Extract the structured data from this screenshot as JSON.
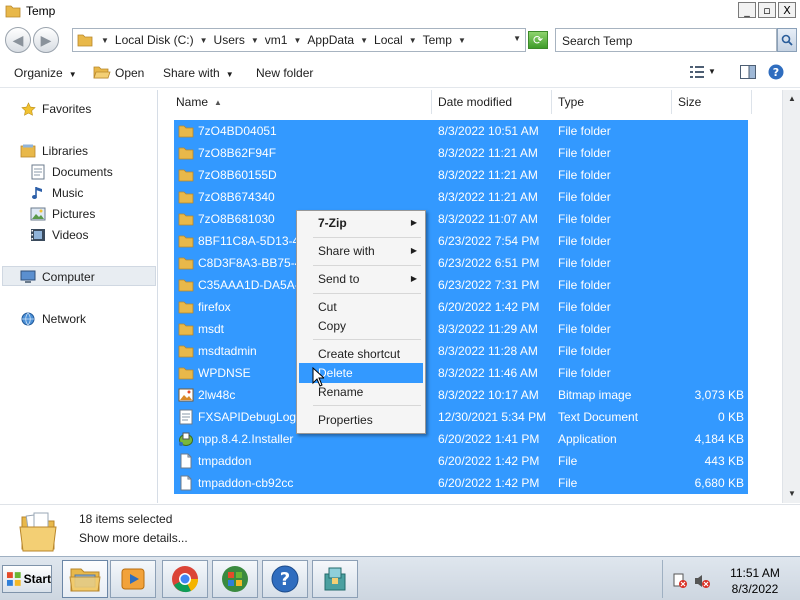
{
  "window": {
    "title": "Temp",
    "minimize_label": "_",
    "maximize_label": "▫",
    "close_label": "X"
  },
  "address": {
    "crumbs": [
      "Local Disk (C:)",
      "Users",
      "vm1",
      "AppData",
      "Local",
      "Temp"
    ],
    "search_placeholder": "Search Temp"
  },
  "commandbar": {
    "organize": "Organize",
    "open": "Open",
    "share_with": "Share with",
    "new_folder": "New folder"
  },
  "nav": {
    "favorites": "Favorites",
    "libraries": "Libraries",
    "documents": "Documents",
    "music": "Music",
    "pictures": "Pictures",
    "videos": "Videos",
    "computer": "Computer",
    "network": "Network"
  },
  "columns": {
    "name": "Name",
    "date_modified": "Date modified",
    "type": "Type",
    "size": "Size"
  },
  "files": [
    {
      "name": "7zO4BD04051",
      "date": "8/3/2022 10:51 AM",
      "type": "File folder",
      "size": "",
      "icon": "folder"
    },
    {
      "name": "7zO8B62F94F",
      "date": "8/3/2022 11:21 AM",
      "type": "File folder",
      "size": "",
      "icon": "folder"
    },
    {
      "name": "7zO8B60155D",
      "date": "8/3/2022 11:21 AM",
      "type": "File folder",
      "size": "",
      "icon": "folder"
    },
    {
      "name": "7zO8B674340",
      "date": "8/3/2022 11:21 AM",
      "type": "File folder",
      "size": "",
      "icon": "folder"
    },
    {
      "name": "7zO8B681030",
      "date": "8/3/2022 11:07 AM",
      "type": "File folder",
      "size": "",
      "icon": "folder"
    },
    {
      "name": "8BF11C8A-5D13-4",
      "date": "6/23/2022 7:54 PM",
      "type": "File folder",
      "size": "",
      "icon": "folder"
    },
    {
      "name": "C8D3F8A3-BB75-4",
      "date": "6/23/2022 6:51 PM",
      "type": "File folder",
      "size": "",
      "icon": "folder"
    },
    {
      "name": "C35AAA1D-DA5A-",
      "date": "6/23/2022 7:31 PM",
      "type": "File folder",
      "size": "",
      "icon": "folder"
    },
    {
      "name": "firefox",
      "date": "6/20/2022 1:42 PM",
      "type": "File folder",
      "size": "",
      "icon": "folder"
    },
    {
      "name": "msdt",
      "date": "8/3/2022 11:29 AM",
      "type": "File folder",
      "size": "",
      "icon": "folder"
    },
    {
      "name": "msdtadmin",
      "date": "8/3/2022 11:28 AM",
      "type": "File folder",
      "size": "",
      "icon": "folder"
    },
    {
      "name": "WPDNSE",
      "date": "8/3/2022 11:46 AM",
      "type": "File folder",
      "size": "",
      "icon": "folder"
    },
    {
      "name": "2lw48c",
      "date": "8/3/2022 10:17 AM",
      "type": "Bitmap image",
      "size": "3,073 KB",
      "icon": "bitmap"
    },
    {
      "name": "FXSAPIDebugLogF",
      "date": "12/30/2021 5:34 PM",
      "type": "Text Document",
      "size": "0 KB",
      "icon": "text"
    },
    {
      "name": "npp.8.4.2.Installer",
      "date": "6/20/2022 1:41 PM",
      "type": "Application",
      "size": "4,184 KB",
      "icon": "app"
    },
    {
      "name": "tmpaddon",
      "date": "6/20/2022 1:42 PM",
      "type": "File",
      "size": "443 KB",
      "icon": "file"
    },
    {
      "name": "tmpaddon-cb92cc",
      "date": "6/20/2022 1:42 PM",
      "type": "File",
      "size": "6,680 KB",
      "icon": "file"
    }
  ],
  "context_menu": {
    "items": [
      {
        "label": "7-Zip",
        "submenu": true,
        "bold": true
      },
      {
        "label": "Share with",
        "submenu": true
      },
      {
        "label": "Send to",
        "submenu": true
      },
      {
        "label": "Cut"
      },
      {
        "label": "Copy"
      },
      {
        "label": "Create shortcut"
      },
      {
        "label": "Delete",
        "highlighted": true
      },
      {
        "label": "Rename"
      },
      {
        "label": "Properties"
      }
    ]
  },
  "details": {
    "selected": "18 items selected",
    "more": "Show more details..."
  },
  "taskbar": {
    "start": "Start",
    "time": "11:51 AM",
    "date": "8/3/2022"
  },
  "colors": {
    "selection": "#3399ff",
    "folder": "#e8b84a"
  }
}
